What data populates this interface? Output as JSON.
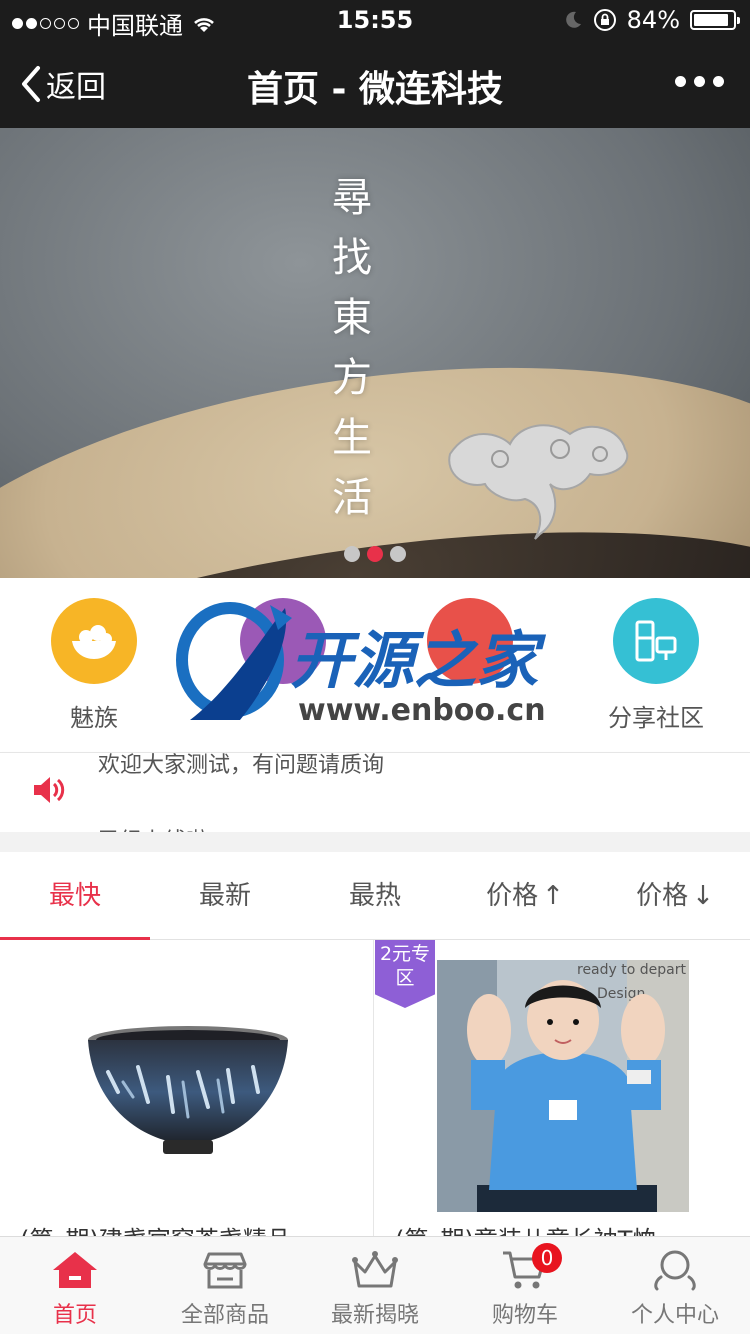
{
  "status_bar": {
    "carrier": "中国联通",
    "time": "15:55",
    "battery": "84%",
    "signal_bars_filled": 2,
    "signal_bars_total": 5
  },
  "nav": {
    "back_label": "返回",
    "title": "首页 - 微连科技"
  },
  "banner": {
    "vertical_text": "尋找東方生活",
    "slide_count": 3,
    "active_slide": 2
  },
  "categories": [
    {
      "label": "魅族",
      "icon": "fruit-bowl-icon",
      "color": "#f7b526"
    },
    {
      "label": "",
      "icon": "purple-icon",
      "color": "#9b59b6"
    },
    {
      "label": "",
      "icon": "red-icon",
      "color": "#e8514a"
    },
    {
      "label": "分享社区",
      "icon": "appliances-icon",
      "color": "#35c0d4"
    }
  ],
  "watermark": {
    "brand": "开源之家",
    "url": "www.enboo.cn"
  },
  "notice": {
    "line1": "欢迎大家测试，有问题请质询",
    "line2": "已经上线啦"
  },
  "sort_tabs": [
    {
      "label": "最快",
      "active": true
    },
    {
      "label": "最新",
      "active": false
    },
    {
      "label": "最热",
      "active": false
    },
    {
      "label": "价格",
      "arrow": "↑",
      "active": false
    },
    {
      "label": "价格",
      "arrow": "↓",
      "active": false
    }
  ],
  "products": [
    {
      "title": "(第_期)建盏官窑茶盏精品",
      "badge": ""
    },
    {
      "title": "(第_期)童装儿童长袖T恤",
      "badge": "2元专区"
    }
  ],
  "tabbar": [
    {
      "label": "首页",
      "icon": "home-icon",
      "active": true
    },
    {
      "label": "全部商品",
      "icon": "store-icon",
      "active": false
    },
    {
      "label": "最新揭晓",
      "icon": "crown-icon",
      "active": false
    },
    {
      "label": "购物车",
      "icon": "cart-icon",
      "active": false,
      "badge": "0"
    },
    {
      "label": "个人中心",
      "icon": "user-icon",
      "active": false
    }
  ],
  "colors": {
    "accent": "#e8314a",
    "nav_bg": "#1c1c1c",
    "badge_purple": "#8e5fd6"
  }
}
